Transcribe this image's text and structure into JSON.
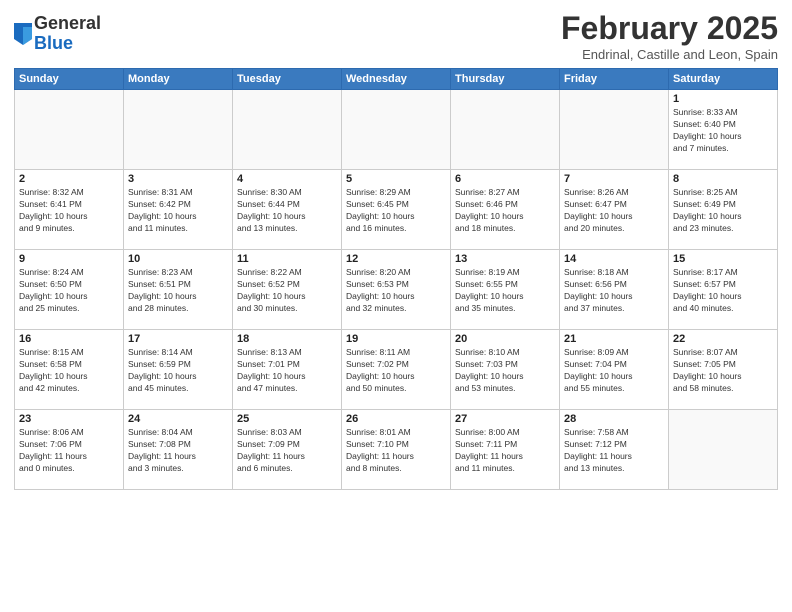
{
  "header": {
    "logo_general": "General",
    "logo_blue": "Blue",
    "month_title": "February 2025",
    "subtitle": "Endrinal, Castille and Leon, Spain"
  },
  "weekdays": [
    "Sunday",
    "Monday",
    "Tuesday",
    "Wednesday",
    "Thursday",
    "Friday",
    "Saturday"
  ],
  "weeks": [
    [
      {
        "day": "",
        "info": ""
      },
      {
        "day": "",
        "info": ""
      },
      {
        "day": "",
        "info": ""
      },
      {
        "day": "",
        "info": ""
      },
      {
        "day": "",
        "info": ""
      },
      {
        "day": "",
        "info": ""
      },
      {
        "day": "1",
        "info": "Sunrise: 8:33 AM\nSunset: 6:40 PM\nDaylight: 10 hours\nand 7 minutes."
      }
    ],
    [
      {
        "day": "2",
        "info": "Sunrise: 8:32 AM\nSunset: 6:41 PM\nDaylight: 10 hours\nand 9 minutes."
      },
      {
        "day": "3",
        "info": "Sunrise: 8:31 AM\nSunset: 6:42 PM\nDaylight: 10 hours\nand 11 minutes."
      },
      {
        "day": "4",
        "info": "Sunrise: 8:30 AM\nSunset: 6:44 PM\nDaylight: 10 hours\nand 13 minutes."
      },
      {
        "day": "5",
        "info": "Sunrise: 8:29 AM\nSunset: 6:45 PM\nDaylight: 10 hours\nand 16 minutes."
      },
      {
        "day": "6",
        "info": "Sunrise: 8:27 AM\nSunset: 6:46 PM\nDaylight: 10 hours\nand 18 minutes."
      },
      {
        "day": "7",
        "info": "Sunrise: 8:26 AM\nSunset: 6:47 PM\nDaylight: 10 hours\nand 20 minutes."
      },
      {
        "day": "8",
        "info": "Sunrise: 8:25 AM\nSunset: 6:49 PM\nDaylight: 10 hours\nand 23 minutes."
      }
    ],
    [
      {
        "day": "9",
        "info": "Sunrise: 8:24 AM\nSunset: 6:50 PM\nDaylight: 10 hours\nand 25 minutes."
      },
      {
        "day": "10",
        "info": "Sunrise: 8:23 AM\nSunset: 6:51 PM\nDaylight: 10 hours\nand 28 minutes."
      },
      {
        "day": "11",
        "info": "Sunrise: 8:22 AM\nSunset: 6:52 PM\nDaylight: 10 hours\nand 30 minutes."
      },
      {
        "day": "12",
        "info": "Sunrise: 8:20 AM\nSunset: 6:53 PM\nDaylight: 10 hours\nand 32 minutes."
      },
      {
        "day": "13",
        "info": "Sunrise: 8:19 AM\nSunset: 6:55 PM\nDaylight: 10 hours\nand 35 minutes."
      },
      {
        "day": "14",
        "info": "Sunrise: 8:18 AM\nSunset: 6:56 PM\nDaylight: 10 hours\nand 37 minutes."
      },
      {
        "day": "15",
        "info": "Sunrise: 8:17 AM\nSunset: 6:57 PM\nDaylight: 10 hours\nand 40 minutes."
      }
    ],
    [
      {
        "day": "16",
        "info": "Sunrise: 8:15 AM\nSunset: 6:58 PM\nDaylight: 10 hours\nand 42 minutes."
      },
      {
        "day": "17",
        "info": "Sunrise: 8:14 AM\nSunset: 6:59 PM\nDaylight: 10 hours\nand 45 minutes."
      },
      {
        "day": "18",
        "info": "Sunrise: 8:13 AM\nSunset: 7:01 PM\nDaylight: 10 hours\nand 47 minutes."
      },
      {
        "day": "19",
        "info": "Sunrise: 8:11 AM\nSunset: 7:02 PM\nDaylight: 10 hours\nand 50 minutes."
      },
      {
        "day": "20",
        "info": "Sunrise: 8:10 AM\nSunset: 7:03 PM\nDaylight: 10 hours\nand 53 minutes."
      },
      {
        "day": "21",
        "info": "Sunrise: 8:09 AM\nSunset: 7:04 PM\nDaylight: 10 hours\nand 55 minutes."
      },
      {
        "day": "22",
        "info": "Sunrise: 8:07 AM\nSunset: 7:05 PM\nDaylight: 10 hours\nand 58 minutes."
      }
    ],
    [
      {
        "day": "23",
        "info": "Sunrise: 8:06 AM\nSunset: 7:06 PM\nDaylight: 11 hours\nand 0 minutes."
      },
      {
        "day": "24",
        "info": "Sunrise: 8:04 AM\nSunset: 7:08 PM\nDaylight: 11 hours\nand 3 minutes."
      },
      {
        "day": "25",
        "info": "Sunrise: 8:03 AM\nSunset: 7:09 PM\nDaylight: 11 hours\nand 6 minutes."
      },
      {
        "day": "26",
        "info": "Sunrise: 8:01 AM\nSunset: 7:10 PM\nDaylight: 11 hours\nand 8 minutes."
      },
      {
        "day": "27",
        "info": "Sunrise: 8:00 AM\nSunset: 7:11 PM\nDaylight: 11 hours\nand 11 minutes."
      },
      {
        "day": "28",
        "info": "Sunrise: 7:58 AM\nSunset: 7:12 PM\nDaylight: 11 hours\nand 13 minutes."
      },
      {
        "day": "",
        "info": ""
      }
    ]
  ]
}
